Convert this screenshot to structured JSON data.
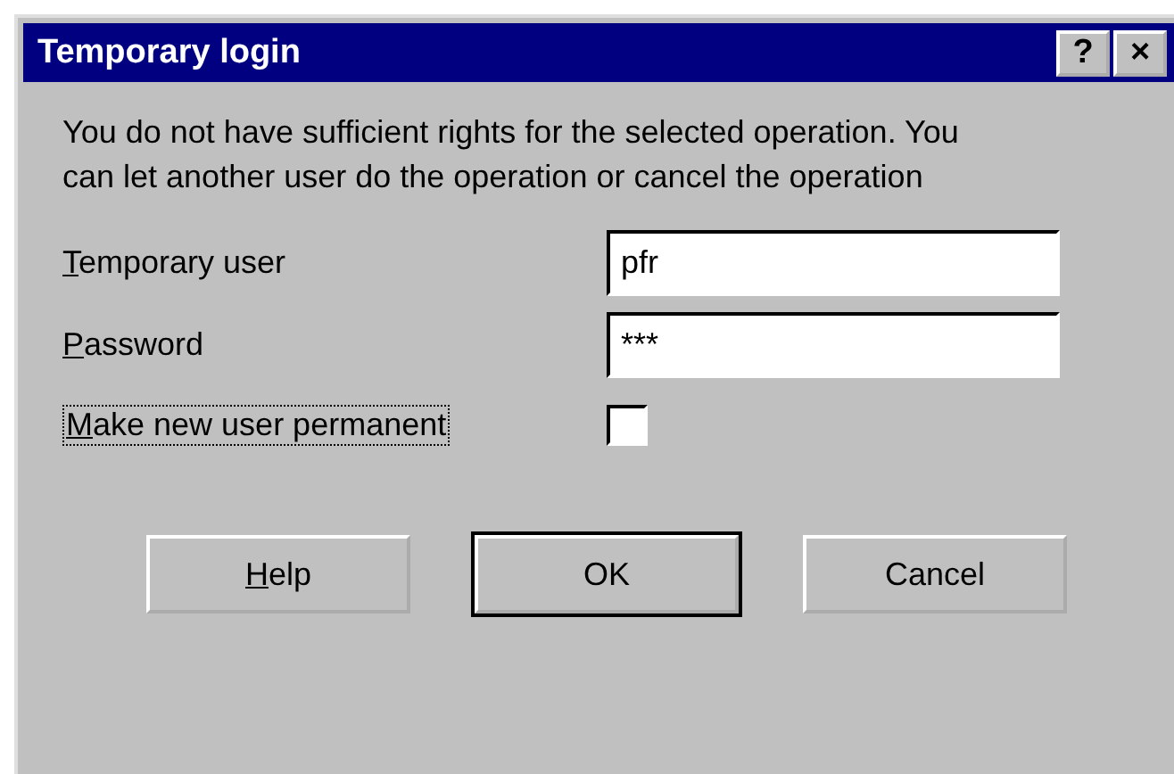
{
  "window": {
    "title": "Temporary login",
    "title_buttons": [
      "?",
      "×"
    ]
  },
  "message": "You do not have sufficient rights for the selected operation. You can let another user do the operation or cancel the operation",
  "fields": [
    {
      "label_key": "T",
      "label_rest": "emporary user",
      "value": "pfr"
    },
    {
      "label_key": "P",
      "label_rest": "assword",
      "value": "***"
    }
  ],
  "checkbox": {
    "label_key": "M",
    "label_rest": "ake new user permanent",
    "checked": false,
    "focused": true
  },
  "buttons": [
    {
      "label_key": "H",
      "label_rest": "elp",
      "default": false
    },
    {
      "label_rest": "OK",
      "default": true
    },
    {
      "label_rest": "Cancel",
      "default": false
    }
  ]
}
